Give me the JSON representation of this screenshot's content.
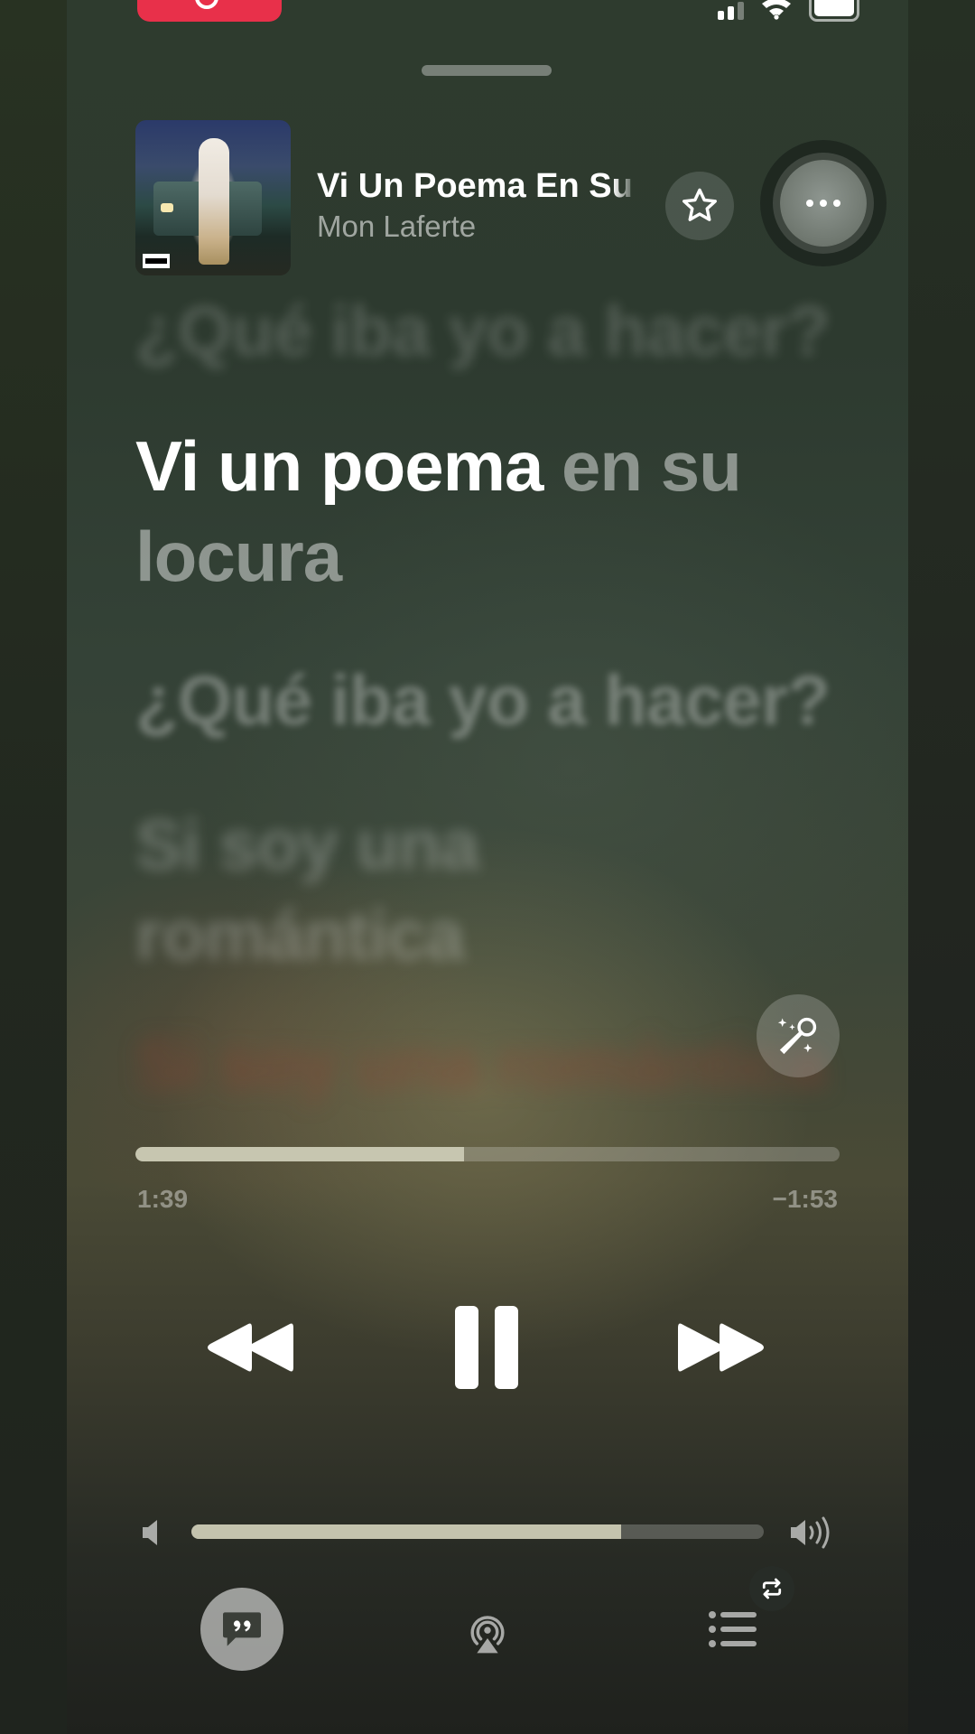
{
  "status_bar": {
    "indicator_color": "#e8304a"
  },
  "now_playing": {
    "title": "Vi Un Poema En Su Locura",
    "artist": "Mon Laferte",
    "artwork_badge": "PARENTAL ADVISORY EXPLICIT CONTENT"
  },
  "lyrics": {
    "previous_line": "¿Qué iba yo a hacer?",
    "active_line_sung": "Vi un poema",
    "active_line_rest": " en su locura",
    "next_line_1": "¿Qué iba yo a hacer?",
    "next_line_2": "Si soy una romántica",
    "next_line_3": "Si soy una romántica"
  },
  "playback": {
    "elapsed": "1:39",
    "remaining": "−1:53",
    "progress_fraction": 0.467
  },
  "volume": {
    "level_fraction": 0.75
  },
  "icons": {
    "header": [
      "star-icon",
      "more-icon"
    ],
    "sing": "microphone-sparkle-icon",
    "transport": [
      "rewind-icon",
      "pause-icon",
      "fast-forward-icon"
    ],
    "volume": [
      "speaker-low-icon",
      "speaker-high-icon"
    ],
    "bottom": [
      "lyrics-icon",
      "airplay-icon",
      "queue-icon",
      "repeat-icon"
    ]
  },
  "colors": {
    "progress_fill": "#c7c6b0",
    "record_indicator": "#e8304a"
  }
}
